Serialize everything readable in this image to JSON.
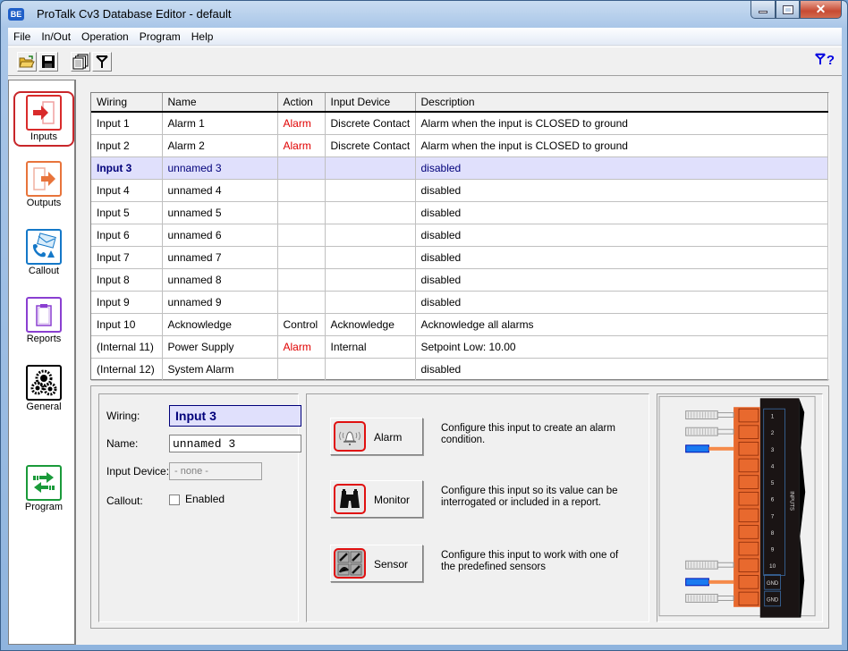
{
  "window": {
    "title": "ProTalk Cv3 Database Editor - default",
    "app_icon": "BE",
    "controls": [
      "minimize",
      "maximize",
      "close"
    ]
  },
  "menubar": {
    "items": [
      "File",
      "In/Out",
      "Operation",
      "Program",
      "Help"
    ]
  },
  "toolbar": {
    "buttons": [
      {
        "name": "open-folder-icon",
        "tooltip": "Open"
      },
      {
        "name": "save-disk-icon",
        "tooltip": "Save"
      },
      {
        "name": "copy-pages-icon",
        "tooltip": "Copy"
      },
      {
        "name": "antenna-icon",
        "tooltip": "Radio"
      }
    ],
    "help_glyph": "?"
  },
  "sidebar": {
    "items": [
      {
        "label": "Inputs",
        "active": true,
        "color": "#d92b2b"
      },
      {
        "label": "Outputs",
        "active": false,
        "color": "#e8743b"
      },
      {
        "label": "Callout",
        "active": false,
        "color": "#1478c8"
      },
      {
        "label": "Reports",
        "active": false,
        "color": "#8a3fd1"
      },
      {
        "label": "General",
        "active": false,
        "color": "#000000"
      },
      {
        "label": "Program",
        "active": false,
        "color": "#1a9a3a"
      }
    ]
  },
  "grid": {
    "columns": [
      "Wiring",
      "Name",
      "Action",
      "Input Device",
      "Description"
    ],
    "rows": [
      {
        "wiring": "Input 1",
        "name": "Alarm 1",
        "action": "Alarm",
        "device": "Discrete Contact",
        "description": "Alarm when the input is CLOSED to ground",
        "selected": false
      },
      {
        "wiring": "Input 2",
        "name": "Alarm 2",
        "action": "Alarm",
        "device": "Discrete Contact",
        "description": "Alarm when the input is CLOSED to ground",
        "selected": false
      },
      {
        "wiring": "Input 3",
        "name": "unnamed 3",
        "action": "",
        "device": "",
        "description": "disabled",
        "selected": true
      },
      {
        "wiring": "Input 4",
        "name": "unnamed 4",
        "action": "",
        "device": "",
        "description": "disabled",
        "selected": false
      },
      {
        "wiring": "Input 5",
        "name": "unnamed 5",
        "action": "",
        "device": "",
        "description": "disabled",
        "selected": false
      },
      {
        "wiring": "Input 6",
        "name": "unnamed 6",
        "action": "",
        "device": "",
        "description": "disabled",
        "selected": false
      },
      {
        "wiring": "Input 7",
        "name": "unnamed 7",
        "action": "",
        "device": "",
        "description": "disabled",
        "selected": false
      },
      {
        "wiring": "Input 8",
        "name": "unnamed 8",
        "action": "",
        "device": "",
        "description": "disabled",
        "selected": false
      },
      {
        "wiring": "Input 9",
        "name": "unnamed 9",
        "action": "",
        "device": "",
        "description": "disabled",
        "selected": false
      },
      {
        "wiring": "Input 10",
        "name": "Acknowledge",
        "action": "Control",
        "device": "Acknowledge",
        "description": "Acknowledge all alarms",
        "selected": false
      },
      {
        "wiring": "(Internal 11)",
        "name": "Power Supply",
        "action": "Alarm",
        "device": "Internal",
        "description": "Setpoint Low: 10.00",
        "selected": false
      },
      {
        "wiring": "(Internal 12)",
        "name": "System Alarm",
        "action": "",
        "device": "",
        "description": "disabled",
        "selected": false
      }
    ]
  },
  "detail": {
    "wiring_label": "Wiring:",
    "wiring_value": "Input 3",
    "name_label": "Name:",
    "name_value": "unnamed 3",
    "device_label": "Input Device:",
    "device_value": "- none -",
    "callout_label": "Callout:",
    "callout_checkbox_label": "Enabled",
    "callout_enabled": false
  },
  "actions": [
    {
      "label": "Alarm",
      "icon": "bell-icon",
      "description": "Configure this input to create an alarm condition."
    },
    {
      "label": "Monitor",
      "icon": "binoculars-icon",
      "description": "Configure this input so its value can be interrogated or included in a report."
    },
    {
      "label": "Sensor",
      "icon": "sensors-icon",
      "description": "Configure this input to work with one of the predefined sensors"
    }
  ],
  "terminal": {
    "labels": [
      "1",
      "2",
      "3",
      "4",
      "5",
      "6",
      "7",
      "8",
      "9",
      "10",
      "GND",
      "GND"
    ],
    "block_label": "INPUTS",
    "highlighted_terminal": "3"
  }
}
